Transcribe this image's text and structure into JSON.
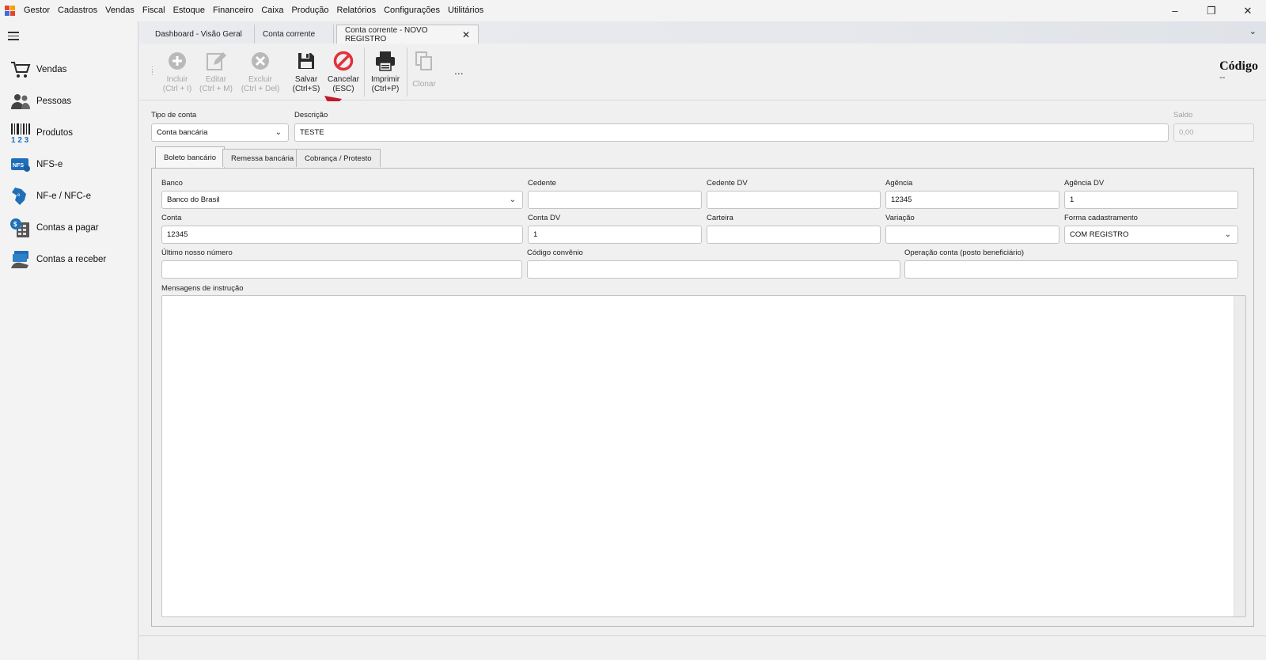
{
  "menubar": {
    "items": [
      "Gestor",
      "Cadastros",
      "Vendas",
      "Fiscal",
      "Estoque",
      "Financeiro",
      "Caixa",
      "Produção",
      "Relatórios",
      "Configurações",
      "Utilitários"
    ]
  },
  "sidebar": {
    "items": [
      {
        "label": "Vendas",
        "icon": "cart-icon"
      },
      {
        "label": "Pessoas",
        "icon": "people-icon"
      },
      {
        "label": "Produtos",
        "icon": "barcode-icon"
      },
      {
        "label": "NFS-e",
        "icon": "nfse-icon"
      },
      {
        "label": "NF-e / NFC-e",
        "icon": "nfe-icon"
      },
      {
        "label": "Contas a pagar",
        "icon": "bill-pay-icon"
      },
      {
        "label": "Contas a receber",
        "icon": "money-receive-icon"
      }
    ]
  },
  "tabs": [
    {
      "label": "Dashboard - Visão Geral"
    },
    {
      "label": "Conta corrente"
    },
    {
      "label": "Conta corrente - NOVO REGISTRO"
    }
  ],
  "toolbar": {
    "incluir": {
      "label": "Incluir",
      "shortcut": "(Ctrl + I)"
    },
    "editar": {
      "label": "Editar",
      "shortcut": "(Ctrl + M)"
    },
    "excluir": {
      "label": "Excluir",
      "shortcut": "(Ctrl + Del)"
    },
    "salvar": {
      "label": "Salvar",
      "shortcut": "(Ctrl+S)"
    },
    "cancelar": {
      "label": "Cancelar",
      "shortcut": "(ESC)"
    },
    "imprimir": {
      "label": "Imprimir",
      "shortcut": "(Ctrl+P)"
    },
    "clonar": {
      "label": "Clonar"
    },
    "more": "..."
  },
  "codigo": {
    "title": "Código",
    "value": "--"
  },
  "form": {
    "tipo_conta": {
      "label": "Tipo de conta",
      "value": "Conta bancária"
    },
    "descricao": {
      "label": "Descrição",
      "value": "TESTE"
    },
    "saldo": {
      "label": "Saldo",
      "value": "0,00"
    }
  },
  "inner_tabs": [
    "Boleto bancário",
    "Remessa bancária",
    "Cobrança / Protesto"
  ],
  "boleto": {
    "banco": {
      "label": "Banco",
      "value": "Banco do Brasil"
    },
    "cedente": {
      "label": "Cedente",
      "value": ""
    },
    "cedente_dv": {
      "label": "Cedente DV",
      "value": ""
    },
    "agencia": {
      "label": "Agência",
      "value": "12345"
    },
    "agencia_dv": {
      "label": "Agência DV",
      "value": "1"
    },
    "conta": {
      "label": "Conta",
      "value": "12345"
    },
    "conta_dv": {
      "label": "Conta DV",
      "value": "1"
    },
    "carteira": {
      "label": "Carteira",
      "value": ""
    },
    "variacao": {
      "label": "Variação",
      "value": ""
    },
    "forma_cadastramento": {
      "label": "Forma cadastramento",
      "value": "COM REGISTRO"
    },
    "ultimo_nosso_numero": {
      "label": "Último nosso número",
      "value": ""
    },
    "codigo_convenio": {
      "label": "Código convênio",
      "value": ""
    },
    "operacao_conta": {
      "label": "Operação conta (posto beneficiário)",
      "value": ""
    },
    "mensagens": {
      "label": "Mensagens de instrução",
      "value": ""
    }
  },
  "colors": {
    "accent_red": "#c0192c",
    "cancel_red": "#e0323c",
    "blue_icon": "#1f6fb8"
  }
}
